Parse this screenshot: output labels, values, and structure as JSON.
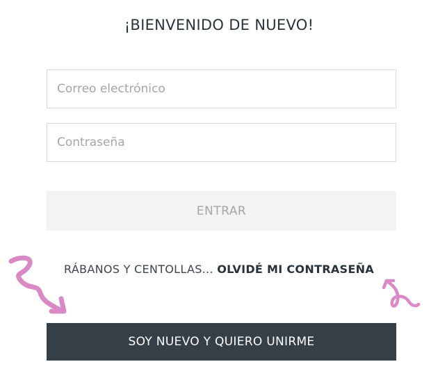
{
  "header": {
    "title": "¡BIENVENIDO DE NUEVO!"
  },
  "form": {
    "email_placeholder": "Correo electrónico",
    "password_placeholder": "Contraseña",
    "enter_label": "ENTRAR"
  },
  "forgot": {
    "prefix": "RÁBANOS Y CENTOLLAS...",
    "link_label": "OLVIDÉ MI CONTRASEÑA"
  },
  "join": {
    "label": "SOY NUEVO Y QUIERO UNIRME"
  },
  "decor": {
    "doodle_color": "#d98ac4",
    "left_icon": "squiggle-arrow-icon",
    "right_icon": "loop-arrow-icon"
  }
}
